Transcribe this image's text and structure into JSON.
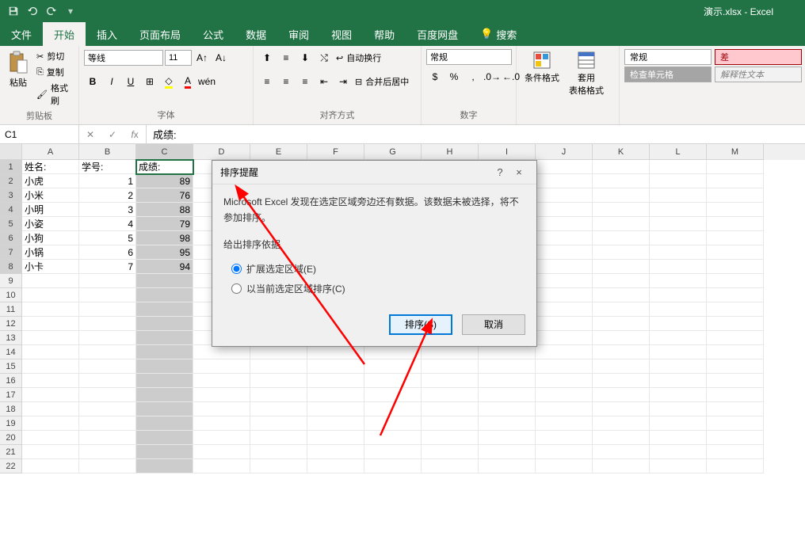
{
  "app": {
    "title": "演示.xlsx - Excel"
  },
  "qat": {
    "save_icon": "save-icon",
    "undo_icon": "undo-icon",
    "redo_icon": "redo-icon"
  },
  "tabs": {
    "file": "文件",
    "home": "开始",
    "insert": "插入",
    "layout": "页面布局",
    "formula": "公式",
    "data": "数据",
    "review": "审阅",
    "view": "视图",
    "help": "帮助",
    "baidu": "百度网盘",
    "search": "搜索"
  },
  "ribbon": {
    "clipboard": {
      "label": "剪贴板",
      "paste": "粘贴",
      "cut": "剪切",
      "copy": "复制",
      "format_painter": "格式刷"
    },
    "font": {
      "label": "字体",
      "name": "等线",
      "size": "11",
      "bold": "B",
      "italic": "I",
      "underline": "U"
    },
    "align": {
      "label": "对齐方式",
      "wrap": "自动换行",
      "merge": "合并后居中"
    },
    "number": {
      "label": "数字",
      "format": "常规"
    },
    "styles": {
      "cond": "条件格式",
      "table": "套用\n表格格式",
      "normal": "常规",
      "bad": "差",
      "check": "检查单元格",
      "explain": "解释性文本"
    }
  },
  "formula_bar": {
    "name_box": "C1",
    "value": "成绩:"
  },
  "columns": [
    "A",
    "B",
    "C",
    "D",
    "E",
    "F",
    "G",
    "H",
    "I",
    "J",
    "K",
    "L",
    "M"
  ],
  "sel_col": "C",
  "rows": [
    {
      "n": 1,
      "A": "姓名:",
      "B": "学号:",
      "C": "成绩:"
    },
    {
      "n": 2,
      "A": "小虎",
      "B": "1",
      "C": "89"
    },
    {
      "n": 3,
      "A": "小米",
      "B": "2",
      "C": "76"
    },
    {
      "n": 4,
      "A": "小明",
      "B": "3",
      "C": "88"
    },
    {
      "n": 5,
      "A": "小姿",
      "B": "4",
      "C": "79"
    },
    {
      "n": 6,
      "A": "小狗",
      "B": "5",
      "C": "98"
    },
    {
      "n": 7,
      "A": "小锅",
      "B": "6",
      "C": "95"
    },
    {
      "n": 8,
      "A": "小卡",
      "B": "7",
      "C": "94"
    },
    {
      "n": 9
    },
    {
      "n": 10
    },
    {
      "n": 11
    },
    {
      "n": 12
    },
    {
      "n": 13
    },
    {
      "n": 14
    },
    {
      "n": 15
    },
    {
      "n": 16
    },
    {
      "n": 17
    },
    {
      "n": 18
    },
    {
      "n": 19
    },
    {
      "n": 20
    },
    {
      "n": 21
    },
    {
      "n": 22
    }
  ],
  "dialog": {
    "title": "排序提醒",
    "message": "Microsoft Excel 发现在选定区域旁边还有数据。该数据未被选择，将不参加排序。",
    "subhead": "给出排序依据",
    "opt1": "扩展选定区域(E)",
    "opt2": "以当前选定区域排序(C)",
    "ok": "排序(S)",
    "cancel": "取消",
    "help": "?",
    "close": "×"
  }
}
